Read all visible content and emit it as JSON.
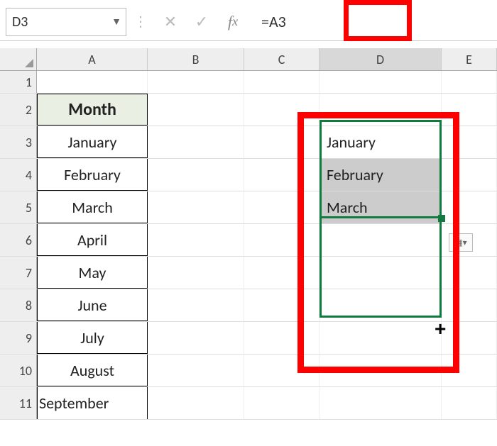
{
  "formula_bar": {
    "name_box": "D3",
    "formula": "=A3",
    "cancel_tip": "Cancel",
    "accept_tip": "Enter",
    "fx_tip": "Insert Function"
  },
  "columns": [
    "A",
    "B",
    "C",
    "D",
    "E"
  ],
  "row_numbers": [
    "1",
    "2",
    "3",
    "4",
    "5",
    "6",
    "7",
    "8",
    "9",
    "10",
    "11"
  ],
  "colA": {
    "header": "Month",
    "values": [
      "January",
      "February",
      "March",
      "April",
      "May",
      "June",
      "July",
      "August",
      "September"
    ]
  },
  "colD": {
    "values": [
      "January",
      "February",
      "March"
    ]
  },
  "autofill_tip": "Auto Fill Options",
  "chart_data": {
    "type": "table",
    "title": "Excel worksheet with formula fill",
    "cells": [
      {
        "ref": "A2",
        "value": "Month",
        "style": "header"
      },
      {
        "ref": "A3",
        "value": "January"
      },
      {
        "ref": "A4",
        "value": "February"
      },
      {
        "ref": "A5",
        "value": "March"
      },
      {
        "ref": "A6",
        "value": "April"
      },
      {
        "ref": "A7",
        "value": "May"
      },
      {
        "ref": "A8",
        "value": "June"
      },
      {
        "ref": "A9",
        "value": "July"
      },
      {
        "ref": "A10",
        "value": "August"
      },
      {
        "ref": "A11",
        "value": "September"
      },
      {
        "ref": "D3",
        "formula": "=A3",
        "value": "January"
      },
      {
        "ref": "D4",
        "value": "February"
      },
      {
        "ref": "D5",
        "value": "March"
      }
    ],
    "active_cell": "D3",
    "selection": "D3:D5",
    "fill_preview": "D6:D8"
  }
}
